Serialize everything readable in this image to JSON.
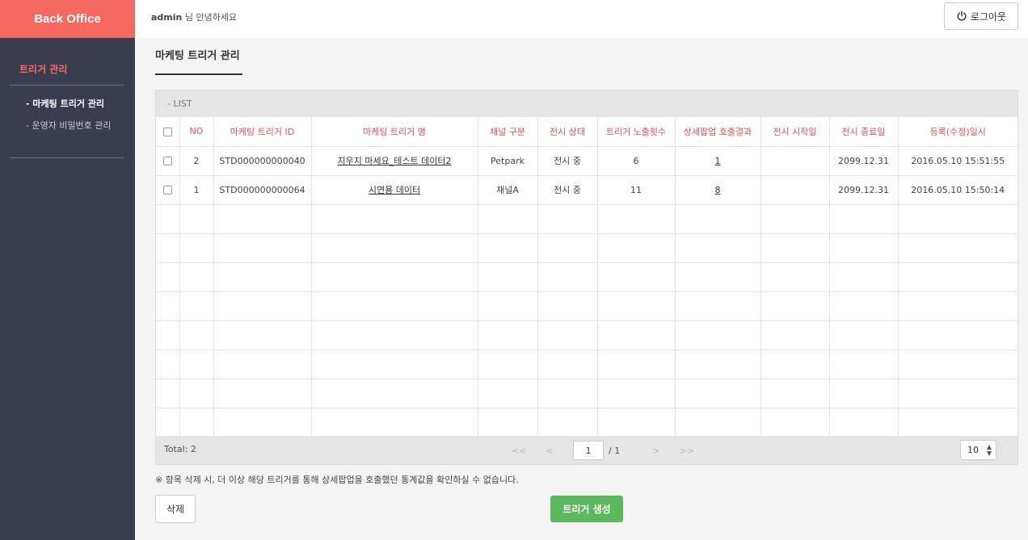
{
  "sidebar": {
    "brand": "Back Office",
    "section_title": "트리거 관리",
    "items": [
      {
        "label": "- 마케팅 트리거 관리",
        "active": true
      },
      {
        "label": "- 운영자 비밀번호 관리",
        "active": false
      }
    ]
  },
  "topbar": {
    "user": "admin",
    "greeting_suffix": " 님 안녕하세요",
    "logout_label": "로그아웃",
    "logout_icon": "power-icon"
  },
  "page": {
    "title": "마케팅 트리거 관리",
    "list_label": "- LIST"
  },
  "table": {
    "columns": [
      "NO",
      "마케팅 트리거 ID",
      "마케팅 트리거 명",
      "채널 구분",
      "전시 상태",
      "트리거 노출횟수",
      "상세팝업 호출결과",
      "전시 시작일",
      "전시 종료일",
      "등록(수정)일시"
    ],
    "rows": [
      {
        "no": "2",
        "id": "STD000000000040",
        "name": "지우지 마세요_테스트 데이터2",
        "channel": "Petpark",
        "status": "전시 중",
        "exposure": "6",
        "popup": "1",
        "start": "",
        "end": "2099.12.31",
        "registered": "2016.05.10 15:51:55"
      },
      {
        "no": "1",
        "id": "STD000000000064",
        "name": "시연용 데이터",
        "channel": "채널A",
        "status": "전시 중",
        "exposure": "11",
        "popup": "8",
        "start": "",
        "end": "2099.12.31",
        "registered": "2016.05.10 15:50:14"
      }
    ],
    "empty_rows": 8
  },
  "pagination": {
    "total": "Total: 2",
    "first": "<<",
    "prev": "<",
    "current": "1",
    "of_total": "/ 1",
    "next": ">",
    "last": ">>",
    "page_size": "10"
  },
  "notice": "※ 항목 삭제 시, 더 이상 해당 트리거를 통해 상세팝업을 호출했던 통계값을 확인하실 수 없습니다.",
  "actions": {
    "delete_label": "삭제",
    "create_label": "트리거 생성",
    "create_color": "#5cb85c"
  }
}
